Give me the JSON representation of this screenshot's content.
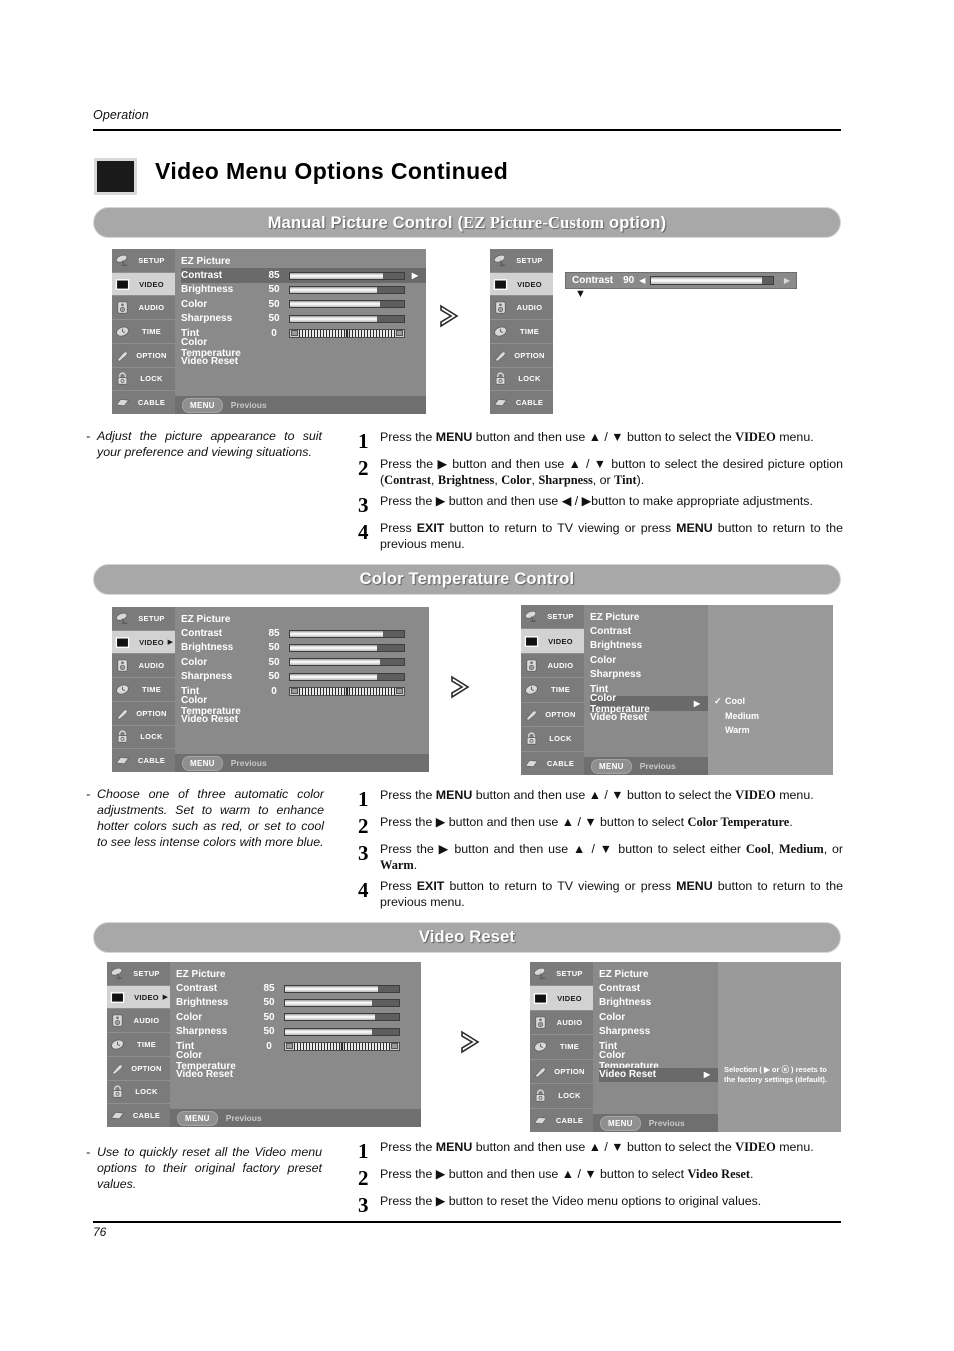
{
  "page": {
    "running_head": "Operation",
    "title": "Video Menu Options Continued",
    "page_number": "76"
  },
  "sidebar_items": [
    {
      "label": "SETUP",
      "icon": "satellite-dish-icon"
    },
    {
      "label": "VIDEO",
      "icon": "display-icon"
    },
    {
      "label": "AUDIO",
      "icon": "speaker-icon"
    },
    {
      "label": "TIME",
      "icon": "clock-icon"
    },
    {
      "label": "OPTION",
      "icon": "wrench-icon"
    },
    {
      "label": "LOCK",
      "icon": "padlock-icon"
    },
    {
      "label": "CABLE",
      "icon": "cable-icon"
    }
  ],
  "osd_footer": {
    "menu_label": "MENU",
    "previous_label": "Previous"
  },
  "sections": [
    {
      "id": "manual-picture-control",
      "banner": {
        "prefix": "Manual Picture Control (",
        "emphasis": "EZ Picture-Custom",
        "suffix": " option)"
      },
      "menu_left": {
        "active_item": "VIDEO",
        "active_arrow": "",
        "heading": "EZ Picture",
        "rows": [
          {
            "name": "Contrast",
            "value": "85",
            "bar": 82,
            "highlight": true,
            "arrow": "▶"
          },
          {
            "name": "Brightness",
            "value": "50",
            "bar": 76
          },
          {
            "name": "Color",
            "value": "50",
            "bar": 79
          },
          {
            "name": "Sharpness",
            "value": "50",
            "bar": 76
          },
          {
            "name": "Tint",
            "value": "0",
            "tint": true
          },
          {
            "name": "Color Temperature",
            "value": ""
          },
          {
            "name": "Video Reset",
            "value": ""
          }
        ]
      },
      "menu_right": {
        "active_item": "VIDEO",
        "float": {
          "name": "Contrast",
          "value": "90",
          "left_arrow": "◀",
          "right_arrow": "▶",
          "bar": 91,
          "caret": "▼"
        }
      },
      "description": "Adjust the picture appearance to suit your preference and viewing situations.",
      "steps": [
        {
          "num": "1",
          "html": "Press the <b>MENU</b> button and then use ▲ / ▼ button to select the <span class='hv'>VIDEO</span> menu."
        },
        {
          "num": "2",
          "html": "Press the ▶ button and then use ▲ / ▼ button to select the desired picture option (<span class='hv'>Contrast</span>, <span class='hv'>Brightness</span>, <span class='hv'>Color</span>, <span class='hv'>Sharpness</span>, or <span class='hv'>Tint</span>)."
        },
        {
          "num": "3",
          "html": "Press the ▶ button and then use ◀ / ▶button to make appropriate adjustments."
        },
        {
          "num": "4",
          "html": "Press <b>EXIT</b> button to return to TV viewing or press <b>MENU</b> button to return to the previous menu."
        }
      ]
    },
    {
      "id": "color-temperature-control",
      "banner": {
        "prefix": "Color Temperature Control",
        "emphasis": "",
        "suffix": ""
      },
      "menu_left": {
        "active_item": "VIDEO",
        "active_arrow": "▶",
        "heading": "EZ Picture",
        "rows": [
          {
            "name": "Contrast",
            "value": "85",
            "bar": 82
          },
          {
            "name": "Brightness",
            "value": "50",
            "bar": 76
          },
          {
            "name": "Color",
            "value": "50",
            "bar": 79
          },
          {
            "name": "Sharpness",
            "value": "50",
            "bar": 76
          },
          {
            "name": "Tint",
            "value": "0",
            "tint": true
          },
          {
            "name": "Color Temperature",
            "value": ""
          },
          {
            "name": "Video Reset",
            "value": ""
          }
        ]
      },
      "menu_right": {
        "active_item": "VIDEO",
        "heading": "EZ Picture",
        "rows": [
          {
            "name": "Contrast"
          },
          {
            "name": "Brightness"
          },
          {
            "name": "Color"
          },
          {
            "name": "Sharpness"
          },
          {
            "name": "Tint"
          },
          {
            "name": "Color Temperature",
            "highlight": true,
            "arrow": "▶"
          },
          {
            "name": "Video Reset"
          }
        ],
        "submenu": [
          {
            "label": "Cool",
            "checked": "✓"
          },
          {
            "label": "Medium",
            "checked": ""
          },
          {
            "label": "Warm",
            "checked": ""
          }
        ]
      },
      "description": "Choose one of three automatic color adjustments. Set to warm to enhance hotter colors such as red, or set to cool to see less intense colors with more blue.",
      "steps": [
        {
          "num": "1",
          "html": "Press the <b>MENU</b> button and then use ▲ / ▼ button to select the <span class='hv'>VIDEO</span> menu."
        },
        {
          "num": "2",
          "html": "Press the ▶ button and then use ▲ / ▼ button to select <span class='hv'>Color Temperature</span>."
        },
        {
          "num": "3",
          "html": "Press the ▶ button and then use ▲ / ▼ button to select either <span class='hv'>Cool</span>, <span class='hv'>Medium</span>, or <span class='hv'>Warm</span>."
        },
        {
          "num": "4",
          "html": "Press <b>EXIT</b> button to return to TV viewing or press <b>MENU</b> button to return to the previous menu."
        }
      ]
    },
    {
      "id": "video-reset",
      "banner": {
        "prefix": "Video Reset",
        "emphasis": "",
        "suffix": ""
      },
      "menu_left": {
        "active_item": "VIDEO",
        "active_arrow": "▶",
        "heading": "EZ Picture",
        "rows": [
          {
            "name": "Contrast",
            "value": "85",
            "bar": 82
          },
          {
            "name": "Brightness",
            "value": "50",
            "bar": 76
          },
          {
            "name": "Color",
            "value": "50",
            "bar": 79
          },
          {
            "name": "Sharpness",
            "value": "50",
            "bar": 76
          },
          {
            "name": "Tint",
            "value": "0",
            "tint": true
          },
          {
            "name": "Color Temperature",
            "value": ""
          },
          {
            "name": "Video Reset",
            "value": ""
          }
        ]
      },
      "menu_right": {
        "active_item": "VIDEO",
        "heading": "EZ Picture",
        "rows": [
          {
            "name": "Contrast"
          },
          {
            "name": "Brightness"
          },
          {
            "name": "Color"
          },
          {
            "name": "Sharpness"
          },
          {
            "name": "Tint"
          },
          {
            "name": "Color Temperature"
          },
          {
            "name": "Video Reset",
            "highlight": true,
            "arrow": "▶"
          }
        ],
        "note": "Selection ( ▶ or ⓔ ) resets to the factory settings (default)."
      },
      "description": "Use to quickly reset all the Video menu options to their original factory preset values.",
      "steps": [
        {
          "num": "1",
          "html": "Press the <b>MENU</b> button and then use ▲ / ▼ button to select the <span class='hv'>VIDEO</span> menu."
        },
        {
          "num": "2",
          "html": "Press the ▶ button and then use ▲ / ▼ button to select <span class='hv'>Video Reset</span>."
        },
        {
          "num": "3",
          "html": "Press the ▶ button to reset the Video menu options to original values."
        }
      ]
    }
  ],
  "colors": {
    "banner_bg": "#a8a8a8",
    "osd_side": "#7b7b7b",
    "osd_body": "#8a8a8a",
    "osd_highlight": "#6a6a6a",
    "osd_active": "#d2d2d2",
    "submenu_bg": "#9a9a9a"
  }
}
